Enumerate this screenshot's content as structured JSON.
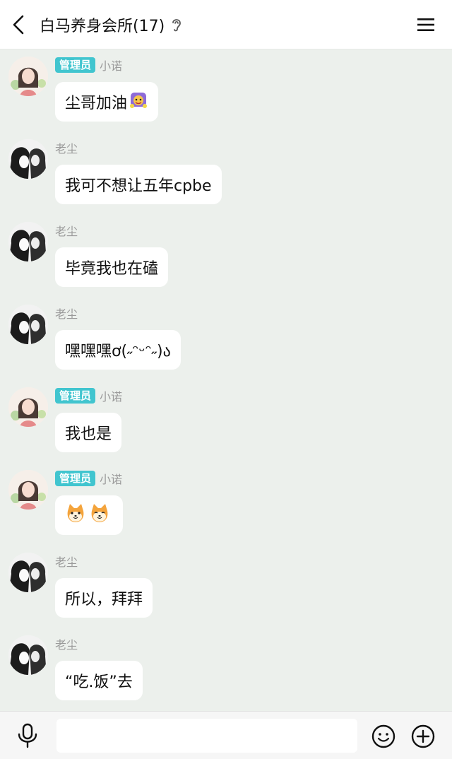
{
  "header": {
    "title": "白马养身会所(17)"
  },
  "messages": [
    {
      "sender": "小诺",
      "badge": "管理员",
      "avatar": "girl-avatar",
      "text": "尘哥加油",
      "emoji": "cheer-sticker"
    },
    {
      "sender": "老尘",
      "badge": "",
      "avatar": "manga-avatar",
      "text": "我可不想让五年cpbe"
    },
    {
      "sender": "老尘",
      "badge": "",
      "avatar": "manga-avatar",
      "text": "毕竟我也在磕"
    },
    {
      "sender": "老尘",
      "badge": "",
      "avatar": "manga-avatar",
      "text": "嘿嘿嘿ơ(˶ᵔᵕᵔ˶)ა"
    },
    {
      "sender": "小诺",
      "badge": "管理员",
      "avatar": "girl-avatar",
      "text": "我也是"
    },
    {
      "sender": "小诺",
      "badge": "管理员",
      "avatar": "girl-avatar",
      "text": "",
      "emoji": "shiba-sticker"
    },
    {
      "sender": "老尘",
      "badge": "",
      "avatar": "manga-avatar",
      "text": "所以，拜拜"
    },
    {
      "sender": "老尘",
      "badge": "",
      "avatar": "manga-avatar",
      "text": "“吃.饭”去"
    }
  ],
  "input": {
    "value": "",
    "placeholder": ""
  },
  "icons": {
    "back": "chevron-left-icon",
    "ear": "ear-icon",
    "menu": "menu-icon",
    "mic": "microphone-icon",
    "emoji": "smiley-icon",
    "plus": "plus-circle-icon"
  },
  "colors": {
    "background": "#ecf0ec",
    "badge": "#41c5cf",
    "bubble": "#ffffff"
  }
}
